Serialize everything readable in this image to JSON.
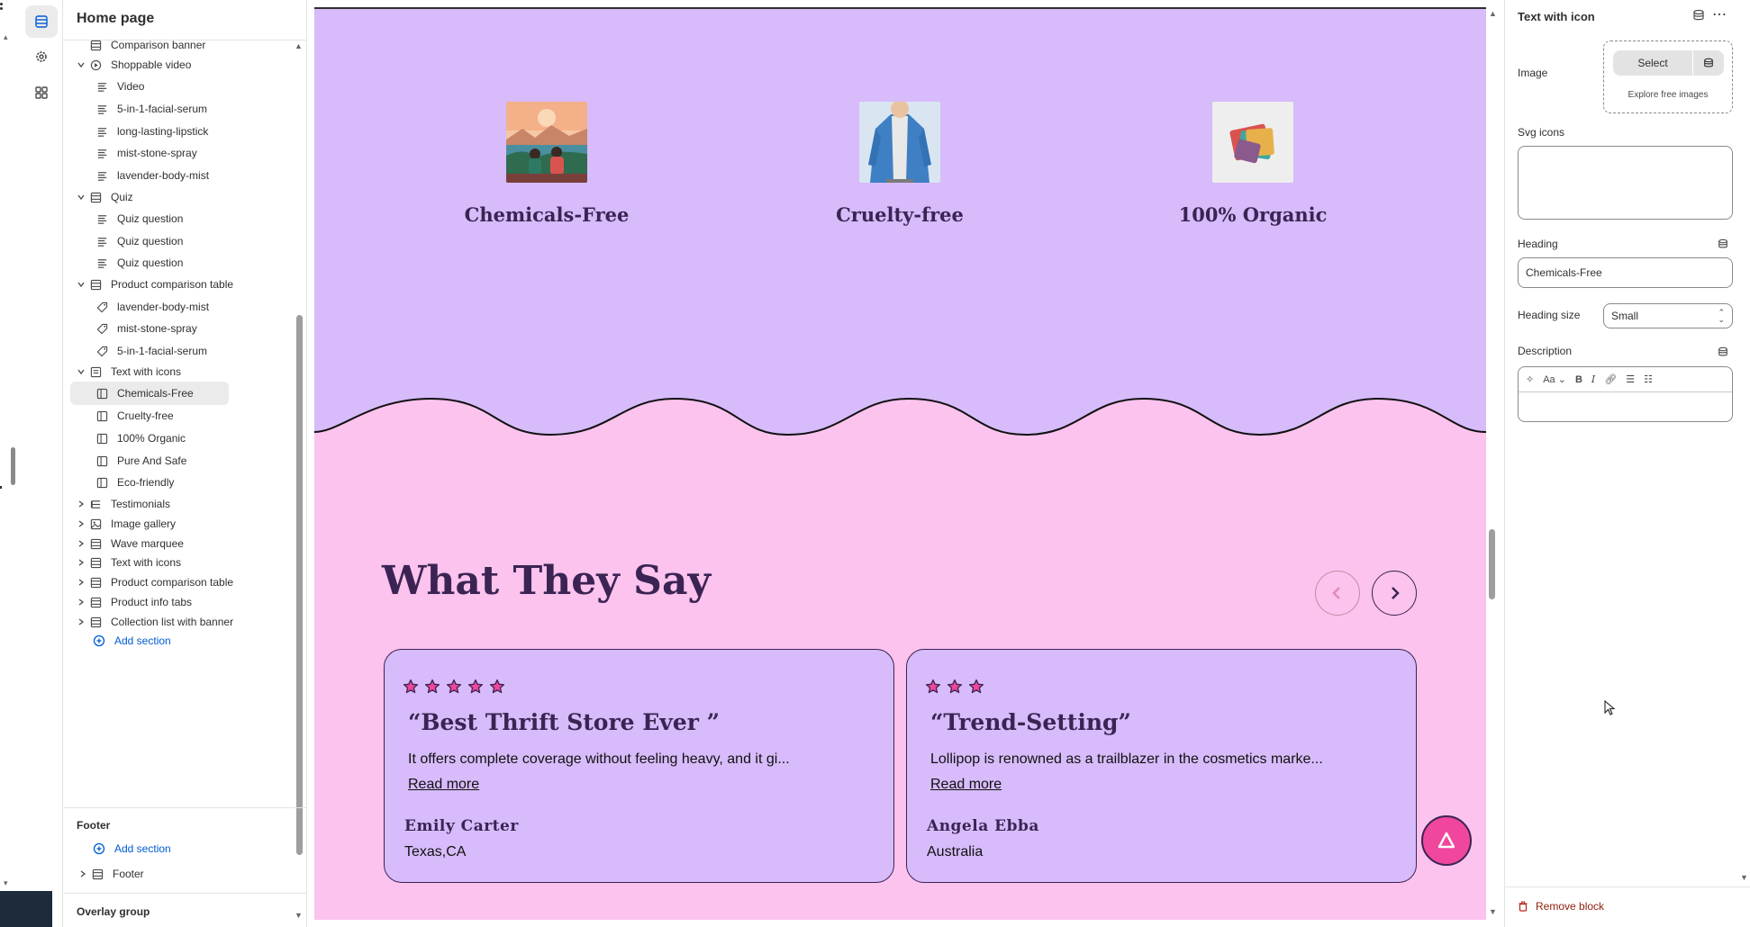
{
  "rail": {
    "icons": [
      "sections-icon",
      "settings-icon",
      "apps-icon"
    ]
  },
  "sidebar": {
    "title": "Home page",
    "items": [
      {
        "label": "Comparison banner",
        "icon": "section-icon",
        "level": 1,
        "chevron": ""
      },
      {
        "label": "Shoppable video",
        "icon": "play-icon",
        "level": 1,
        "chevron": "down"
      },
      {
        "label": "Video",
        "icon": "text-block-icon",
        "level": 2
      },
      {
        "label": "5-in-1-facial-serum",
        "icon": "text-block-icon",
        "level": 2
      },
      {
        "label": "long-lasting-lipstick",
        "icon": "text-block-icon",
        "level": 2
      },
      {
        "label": "mist-stone-spray",
        "icon": "text-block-icon",
        "level": 2
      },
      {
        "label": "lavender-body-mist",
        "icon": "text-block-icon",
        "level": 2
      },
      {
        "label": "Quiz",
        "icon": "section-icon",
        "level": 1,
        "chevron": "down"
      },
      {
        "label": "Quiz question",
        "icon": "text-block-icon",
        "level": 2
      },
      {
        "label": "Quiz question",
        "icon": "text-block-icon",
        "level": 2
      },
      {
        "label": "Quiz question",
        "icon": "text-block-icon",
        "level": 2
      },
      {
        "label": "Product comparison table",
        "icon": "section-icon",
        "level": 1,
        "chevron": "down"
      },
      {
        "label": "lavender-body-mist",
        "icon": "tag-icon",
        "level": 2
      },
      {
        "label": "mist-stone-spray",
        "icon": "tag-icon",
        "level": 2
      },
      {
        "label": "5-in-1-facial-serum",
        "icon": "tag-icon",
        "level": 2
      },
      {
        "label": "Text with icons",
        "icon": "text-section-icon",
        "level": 1,
        "chevron": "down"
      },
      {
        "label": "Chemicals-Free",
        "icon": "block-icon",
        "level": 2,
        "selected": true
      },
      {
        "label": "Cruelty-free",
        "icon": "block-icon",
        "level": 2
      },
      {
        "label": "100% Organic",
        "icon": "block-icon",
        "level": 2
      },
      {
        "label": "Pure And Safe",
        "icon": "block-icon",
        "level": 2
      },
      {
        "label": "Eco-friendly",
        "icon": "block-icon",
        "level": 2
      }
    ],
    "collapsed": [
      {
        "label": "Testimonials",
        "icon": "testimonial-icon"
      },
      {
        "label": "Image gallery",
        "icon": "image-icon"
      },
      {
        "label": "Wave marquee",
        "icon": "section-icon"
      },
      {
        "label": "Text with icons",
        "icon": "section-icon"
      },
      {
        "label": "Product comparison table",
        "icon": "section-icon"
      },
      {
        "label": "Product info tabs",
        "icon": "section-icon"
      },
      {
        "label": "Collection list with banner",
        "icon": "section-icon"
      }
    ],
    "add_section": "Add section",
    "footer_heading": "Footer",
    "footer_add_section": "Add section",
    "footer_item": "Footer",
    "overlay_heading": "Overlay group"
  },
  "preview": {
    "features": [
      {
        "title": "Chemicals-Free",
        "image": "couple-at-lake-illustration"
      },
      {
        "title": "Cruelty-free",
        "image": "denim-shirt-photo"
      },
      {
        "title": "100% Organic",
        "image": "folded-clothes-photo"
      }
    ],
    "section_title": "What They Say",
    "testimonials": [
      {
        "rating": 5,
        "title": "“Best Thrift Store Ever ”",
        "body": "It offers complete coverage without feeling heavy, and it gi...",
        "read_more": "Read more",
        "name": "Emily Carter",
        "location": "Texas,CA"
      },
      {
        "rating": 3,
        "title": "“Trend-Setting”",
        "body": "Lollipop is renowned as a trailblazer in the cosmetics marke...",
        "read_more": "Read more",
        "name": "Angela  Ebba",
        "location": "Australia"
      }
    ],
    "colors": {
      "lavender": "#d7bbfa",
      "pink": "#fbc3ee",
      "accent": "#f0469d",
      "ink": "#3b2453"
    }
  },
  "settings": {
    "title": "Text with icon",
    "image_label": "Image",
    "select_button": "Select",
    "explore_link": "Explore free images",
    "svg_label": "Svg icons",
    "svg_value": "",
    "heading_label": "Heading",
    "heading_value": "Chemicals-Free",
    "heading_size_label": "Heading size",
    "heading_size_value": "Small",
    "description_label": "Description",
    "description_value": "",
    "remove_button": "Remove block"
  }
}
